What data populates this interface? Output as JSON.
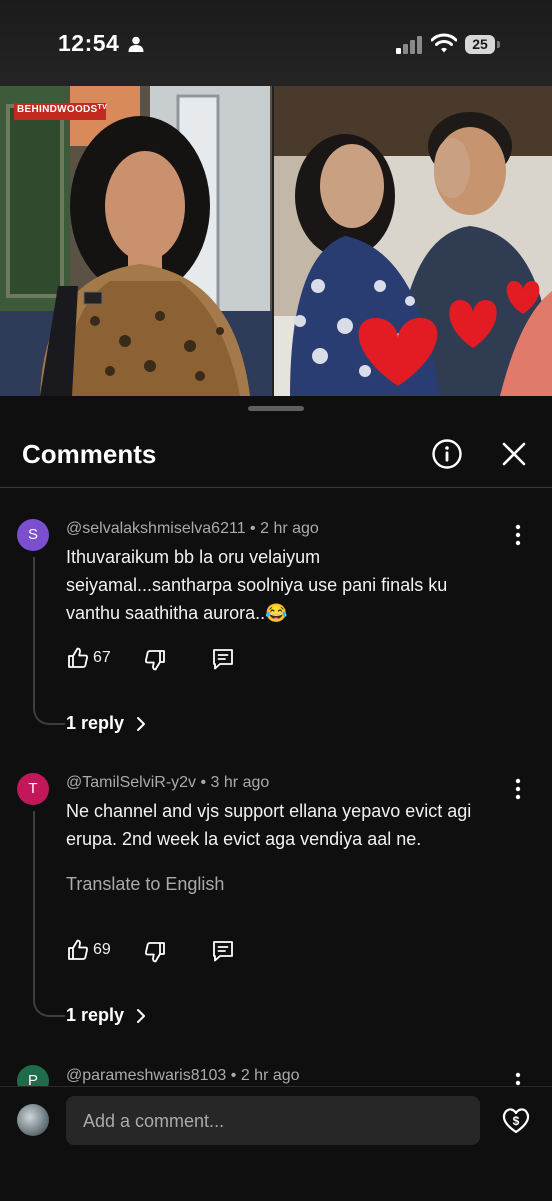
{
  "status_bar": {
    "time": "12:54",
    "battery": "25"
  },
  "video": {
    "logo": "BEHINDWOODS",
    "logo_suffix": "TV"
  },
  "sheet": {
    "title": "Comments",
    "info_icon": "info-icon",
    "close_icon": "close-icon"
  },
  "comments": [
    {
      "avatar_letter": "S",
      "avatar_color": "#7b4fd0",
      "author": "@selvalakshmiselva6211",
      "time": "2 hr ago",
      "lines": [
        "Ithuvaraikum bb la oru velaiyum",
        "seiyamal...santharpa soolniya use pani finals ku",
        "vanthu saathitha aurora..😂"
      ],
      "likes": "67",
      "replies": "1 reply"
    },
    {
      "avatar_letter": "T",
      "avatar_color": "#c2185b",
      "author": "@TamilSelviR-y2v",
      "time": "3 hr ago",
      "lines": [
        "Ne channel and vjs support ellana yepavo evict agi",
        "erupa. 2nd week la evict aga vendiya aal ne."
      ],
      "translate": "Translate to English",
      "likes": "69",
      "replies": "1 reply"
    },
    {
      "avatar_letter": "P",
      "avatar_color": "#1f6b4a",
      "author": "@parameshwaris8103",
      "time": "2 hr ago"
    }
  ],
  "composer": {
    "placeholder": "Add a comment..."
  }
}
